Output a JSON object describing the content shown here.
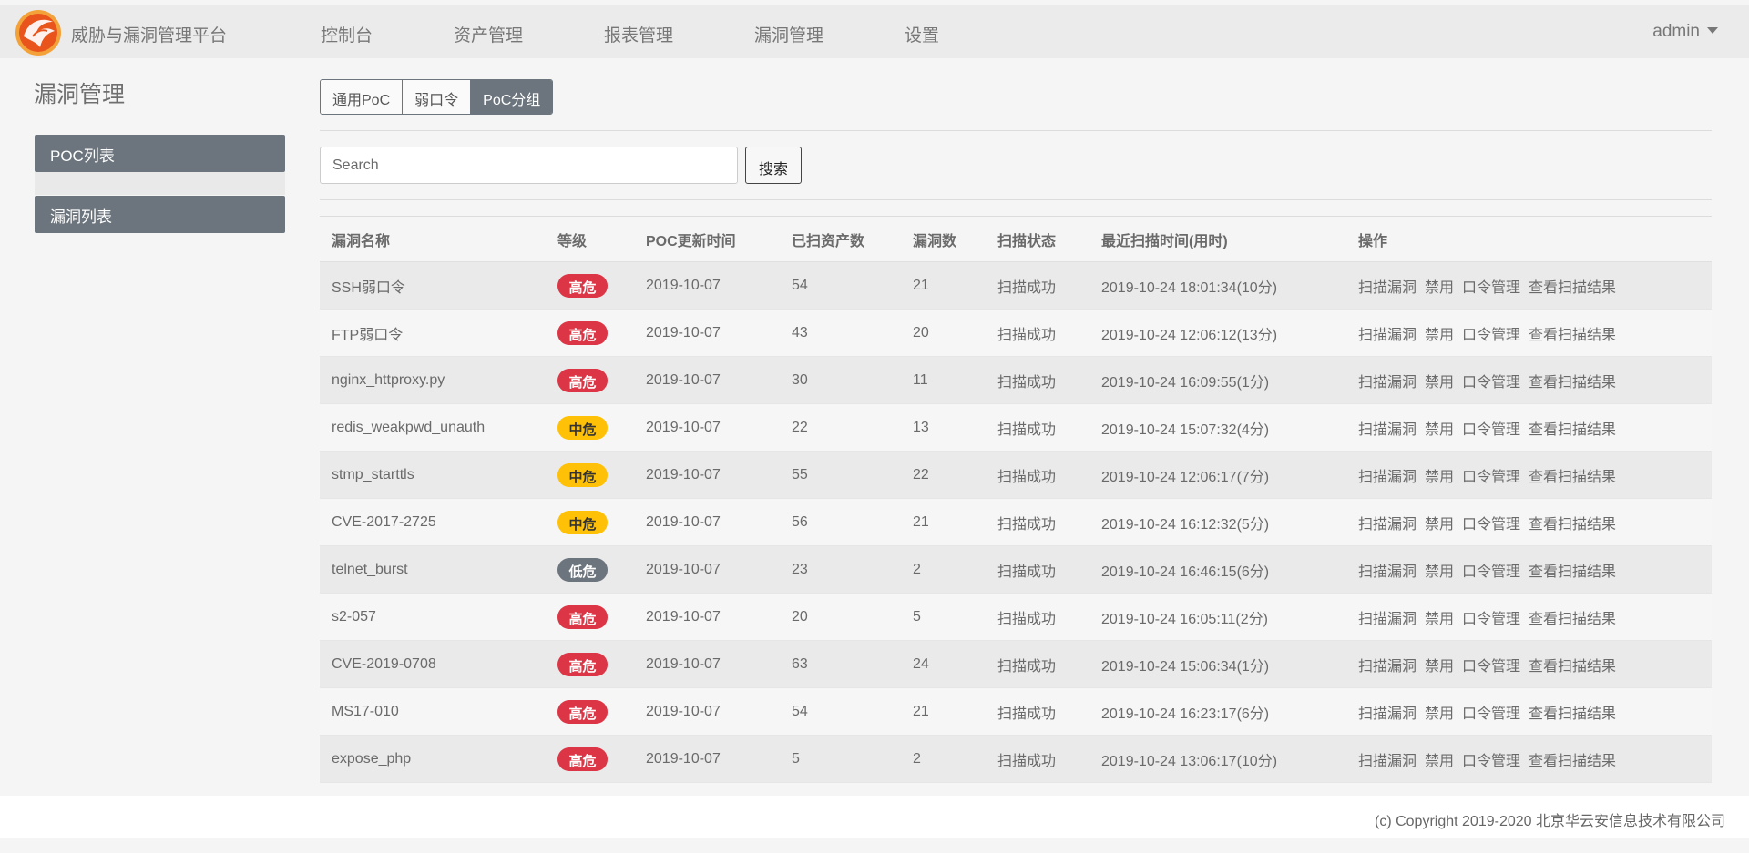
{
  "app": {
    "brand": "威胁与漏洞管理平台"
  },
  "nav": [
    "控制台",
    "资产管理",
    "报表管理",
    "漏洞管理",
    "设置"
  ],
  "user": {
    "name": "admin"
  },
  "page_title": "漏洞管理",
  "sidebar": [
    "POC列表",
    "漏洞列表"
  ],
  "tabs": [
    {
      "label": "通用PoC",
      "active": false
    },
    {
      "label": "弱口令",
      "active": false
    },
    {
      "label": "PoC分组",
      "active": true
    }
  ],
  "search": {
    "placeholder": "Search",
    "button": "搜索"
  },
  "table": {
    "headers": [
      "漏洞名称",
      "等级",
      "POC更新时间",
      "已扫资产数",
      "漏洞数",
      "扫描状态",
      "最近扫描时间(用时)",
      "操作"
    ],
    "actions": [
      "扫描漏洞",
      "禁用",
      "口令管理",
      "查看扫描结果"
    ],
    "rows": [
      {
        "name": "SSH弱口令",
        "level": "高危",
        "updated": "2019-10-07",
        "assets": "54",
        "vulns": "21",
        "status": "扫描成功",
        "last_scan": "2019-10-24 18:01:34(10分)"
      },
      {
        "name": "FTP弱口令",
        "level": "高危",
        "updated": "2019-10-07",
        "assets": "43",
        "vulns": "20",
        "status": "扫描成功",
        "last_scan": "2019-10-24 12:06:12(13分)"
      },
      {
        "name": "nginx_httproxy.py",
        "level": "高危",
        "updated": "2019-10-07",
        "assets": "30",
        "vulns": "11",
        "status": "扫描成功",
        "last_scan": "2019-10-24 16:09:55(1分)"
      },
      {
        "name": "redis_weakpwd_unauth",
        "level": "中危",
        "updated": "2019-10-07",
        "assets": "22",
        "vulns": "13",
        "status": "扫描成功",
        "last_scan": "2019-10-24 15:07:32(4分)"
      },
      {
        "name": "stmp_starttls",
        "level": "中危",
        "updated": "2019-10-07",
        "assets": "55",
        "vulns": "22",
        "status": "扫描成功",
        "last_scan": "2019-10-24 12:06:17(7分)"
      },
      {
        "name": "CVE-2017-2725",
        "level": "中危",
        "updated": "2019-10-07",
        "assets": "56",
        "vulns": "21",
        "status": "扫描成功",
        "last_scan": "2019-10-24 16:12:32(5分)"
      },
      {
        "name": "telnet_burst",
        "level": "低危",
        "updated": "2019-10-07",
        "assets": "23",
        "vulns": "2",
        "status": "扫描成功",
        "last_scan": "2019-10-24 16:46:15(6分)"
      },
      {
        "name": "s2-057",
        "level": "高危",
        "updated": "2019-10-07",
        "assets": "20",
        "vulns": "5",
        "status": "扫描成功",
        "last_scan": "2019-10-24 16:05:11(2分)"
      },
      {
        "name": "CVE-2019-0708",
        "level": "高危",
        "updated": "2019-10-07",
        "assets": "63",
        "vulns": "24",
        "status": "扫描成功",
        "last_scan": "2019-10-24 15:06:34(1分)"
      },
      {
        "name": "MS17-010",
        "level": "高危",
        "updated": "2019-10-07",
        "assets": "54",
        "vulns": "21",
        "status": "扫描成功",
        "last_scan": "2019-10-24 16:23:17(6分)"
      },
      {
        "name": "expose_php",
        "level": "高危",
        "updated": "2019-10-07",
        "assets": "5",
        "vulns": "2",
        "status": "扫描成功",
        "last_scan": "2019-10-24 13:06:17(10分)"
      }
    ]
  },
  "level_colors": {
    "高危": {
      "bg": "#dc3545",
      "fg": "#ffffff"
    },
    "中危": {
      "bg": "#ffc107",
      "fg": "#333333"
    },
    "低危": {
      "bg": "#6c757d",
      "fg": "#ffffff"
    }
  },
  "colors": {
    "accent": "#6c757d",
    "topbar": "#ebebeb",
    "logo": "#e8541c"
  },
  "footer": {
    "copyright": "(c) Copyright 2019-2020 北京华云安信息技术有限公司"
  }
}
